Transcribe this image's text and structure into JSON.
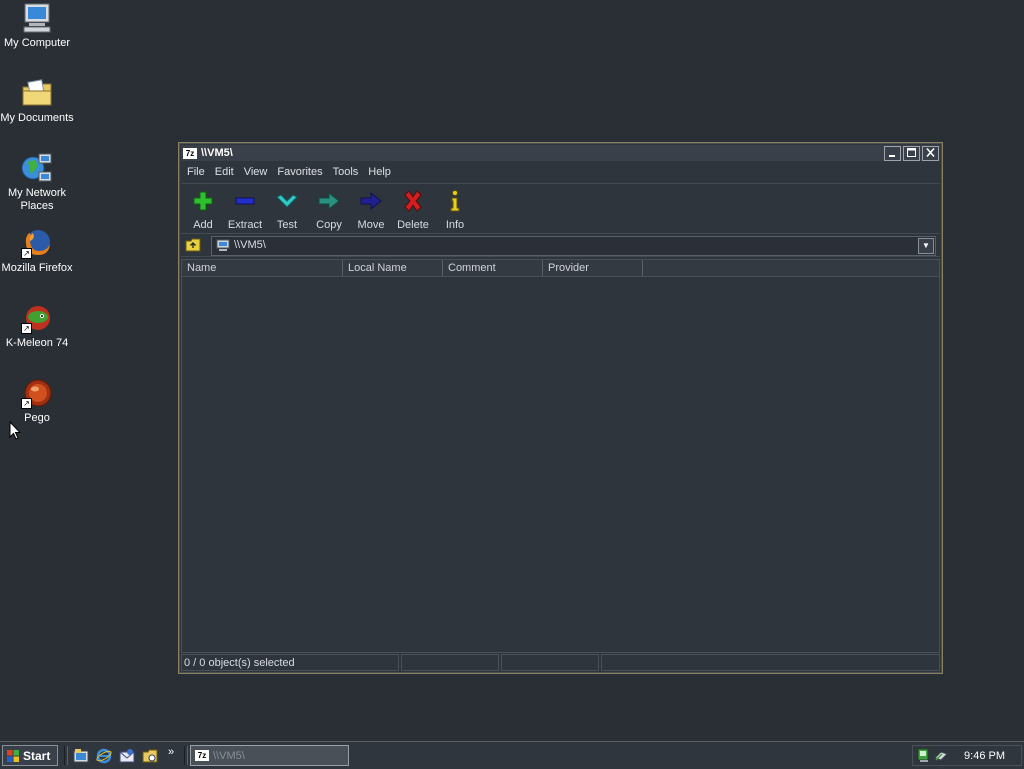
{
  "desktop": {
    "icons": [
      {
        "label": "My Computer",
        "icon": "my-computer-icon"
      },
      {
        "label": "My Documents",
        "icon": "my-documents-icon"
      },
      {
        "label": "My Network Places",
        "icon": "network-places-icon"
      },
      {
        "label": "Mozilla Firefox",
        "icon": "firefox-icon"
      },
      {
        "label": "K-Meleon 74",
        "icon": "kmeleon-icon"
      },
      {
        "label": "Pego",
        "icon": "pego-icon"
      }
    ]
  },
  "window": {
    "app_icon_text": "7z",
    "title": "\\\\VM5\\",
    "menu": [
      "File",
      "Edit",
      "View",
      "Favorites",
      "Tools",
      "Help"
    ],
    "toolbar": [
      {
        "label": "Add",
        "icon": "plus-icon",
        "color": "#2ec02e"
      },
      {
        "label": "Extract",
        "icon": "minus-icon",
        "color": "#2030c8"
      },
      {
        "label": "Test",
        "icon": "check-icon",
        "color": "#30c8c8"
      },
      {
        "label": "Copy",
        "icon": "copy-arrow-icon",
        "color": "#2a9080"
      },
      {
        "label": "Move",
        "icon": "move-arrow-icon",
        "color": "#202090"
      },
      {
        "label": "Delete",
        "icon": "delete-x-icon",
        "color": "#d02020"
      },
      {
        "label": "Info",
        "icon": "info-icon",
        "color": "#e8d020"
      }
    ],
    "address": {
      "value": "\\\\VM5\\"
    },
    "columns": [
      "Name",
      "Local Name",
      "Comment",
      "Provider"
    ],
    "rows": [],
    "status": {
      "selection": "0 / 0 object(s) selected",
      "pane2": "",
      "pane3": "",
      "pane4": ""
    }
  },
  "taskbar": {
    "start_label": "Start",
    "quick_launch": [
      "show-desktop-icon",
      "ie-icon",
      "outlook-icon",
      "explorer-icon"
    ],
    "more": "»",
    "task_button": {
      "app_icon_text": "7z",
      "label": "\\\\VM5\\"
    },
    "tray_icons": [
      "network-tray-icon",
      "volume-tray-icon"
    ],
    "clock": "9:46 PM"
  }
}
